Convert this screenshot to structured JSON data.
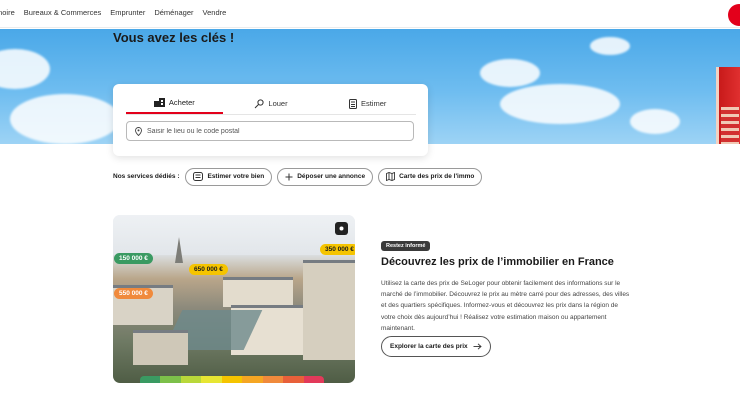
{
  "nav": {
    "items": [
      "moire",
      "Bureaux & Commerces",
      "Emprunter",
      "Déménager",
      "Vendre"
    ]
  },
  "hero": {
    "title": "Vous avez les clés !"
  },
  "search": {
    "tabs": [
      {
        "label": "Acheter",
        "icon": "building-icon",
        "active": true
      },
      {
        "label": "Louer",
        "icon": "key-icon",
        "active": false
      },
      {
        "label": "Estimer",
        "icon": "calculator-icon",
        "active": false
      }
    ],
    "placeholder": "Saisir le lieu ou le code postal"
  },
  "services": {
    "label": "Nos services dédiés :",
    "items": [
      {
        "label": "Estimer votre bien",
        "icon": "estimate-icon"
      },
      {
        "label": "Déposer une annonce",
        "icon": "plus-icon"
      },
      {
        "label": "Carte des prix de l'immo",
        "icon": "map-icon"
      }
    ]
  },
  "promo": {
    "image_prices": [
      "150 000 €",
      "650 000 €",
      "550 000 €",
      "350 000 €"
    ],
    "badge": "Restez informé",
    "title": "Découvrez les prix de l’immobilier en France",
    "description": "Utilisez la carte des prix de SeLoger pour obtenir facilement des informations sur le marché de l’immobilier. Découvrez le prix au mètre carré pour des adresses, des villes et des quartiers spécifiques. Informez-vous et découvrez les prix dans la région de votre choix dès aujourd’hui ! Réalisez votre estimation maison ou appartement maintenant.",
    "button": "Explorer la carte des prix"
  },
  "colors": {
    "accent": "#e3001b",
    "price_green": "#3a9a62",
    "price_yellow": "#f5c400",
    "price_orange": "#f08a3c"
  }
}
